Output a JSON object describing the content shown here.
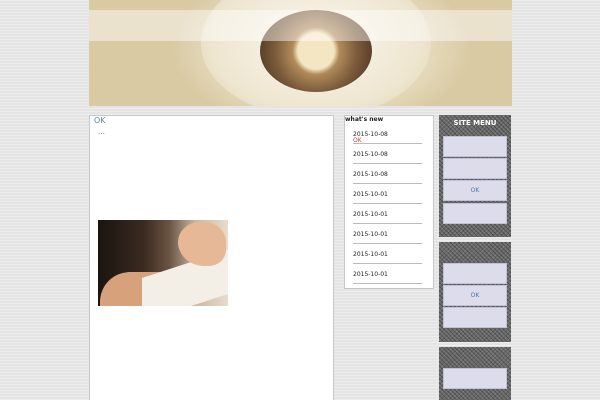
{
  "main": {
    "ok_link": "OK",
    "ellipsis": "…"
  },
  "news": {
    "title": "what's new",
    "items": [
      {
        "date": "2015-10-08",
        "badge": "OK"
      },
      {
        "date": "2015-10-08",
        "badge": ""
      },
      {
        "date": "2015-10-08",
        "badge": ""
      },
      {
        "date": "2015-10-01",
        "badge": ""
      },
      {
        "date": "2015-10-01",
        "badge": ""
      },
      {
        "date": "2015-10-01",
        "badge": ""
      },
      {
        "date": "2015-10-01",
        "badge": ""
      },
      {
        "date": "2015-10-01",
        "badge": ""
      }
    ]
  },
  "menu1": {
    "heading": "SITE MENU",
    "items": [
      "",
      "",
      "OK",
      ""
    ]
  },
  "menu2": {
    "items": [
      "",
      "OK",
      ""
    ]
  },
  "menu3": {
    "items": [
      ""
    ]
  },
  "colors": {
    "badge": "#d23a3a",
    "link": "#5a86a8",
    "menu_button": "#dcdcea"
  }
}
